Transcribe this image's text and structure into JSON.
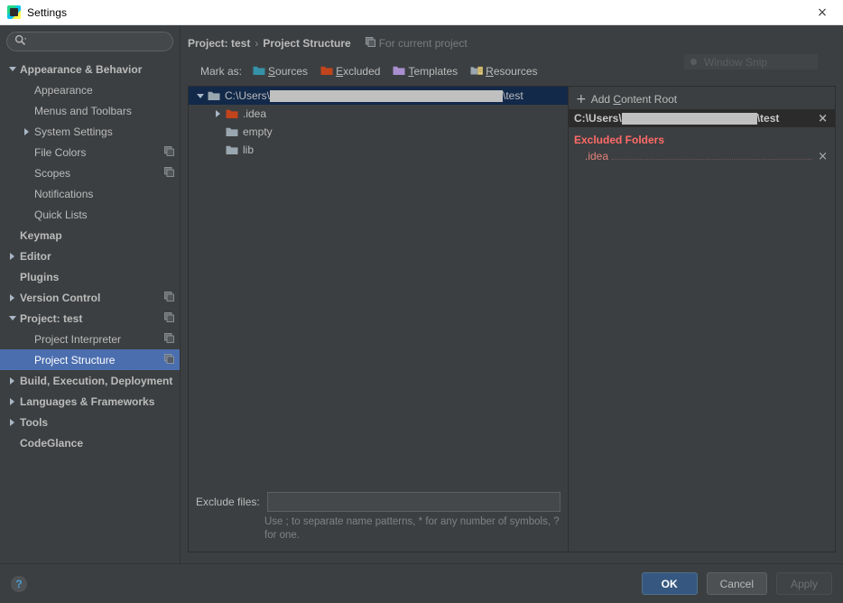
{
  "window": {
    "title": "Settings",
    "close_icon": "×"
  },
  "search": {
    "placeholder": "",
    "value": "",
    "icon": "search-icon"
  },
  "sidebar": {
    "items": [
      {
        "label": "Appearance & Behavior",
        "level": 0,
        "arrow": "expanded",
        "bold": true,
        "badge": false,
        "selected": false
      },
      {
        "label": "Appearance",
        "level": 1,
        "arrow": "none",
        "bold": false,
        "badge": false,
        "selected": false
      },
      {
        "label": "Menus and Toolbars",
        "level": 1,
        "arrow": "none",
        "bold": false,
        "badge": false,
        "selected": false
      },
      {
        "label": "System Settings",
        "level": 1,
        "arrow": "collapsed",
        "bold": false,
        "badge": false,
        "selected": false
      },
      {
        "label": "File Colors",
        "level": 1,
        "arrow": "none",
        "bold": false,
        "badge": true,
        "selected": false
      },
      {
        "label": "Scopes",
        "level": 1,
        "arrow": "none",
        "bold": false,
        "badge": true,
        "selected": false
      },
      {
        "label": "Notifications",
        "level": 1,
        "arrow": "none",
        "bold": false,
        "badge": false,
        "selected": false
      },
      {
        "label": "Quick Lists",
        "level": 1,
        "arrow": "none",
        "bold": false,
        "badge": false,
        "selected": false
      },
      {
        "label": "Keymap",
        "level": 0,
        "arrow": "none",
        "bold": true,
        "badge": false,
        "selected": false
      },
      {
        "label": "Editor",
        "level": 0,
        "arrow": "collapsed",
        "bold": true,
        "badge": false,
        "selected": false
      },
      {
        "label": "Plugins",
        "level": 0,
        "arrow": "none",
        "bold": true,
        "badge": false,
        "selected": false
      },
      {
        "label": "Version Control",
        "level": 0,
        "arrow": "collapsed",
        "bold": true,
        "badge": true,
        "selected": false
      },
      {
        "label": "Project: test",
        "level": 0,
        "arrow": "expanded",
        "bold": true,
        "badge": true,
        "selected": false
      },
      {
        "label": "Project Interpreter",
        "level": 1,
        "arrow": "none",
        "bold": false,
        "badge": true,
        "selected": false
      },
      {
        "label": "Project Structure",
        "level": 1,
        "arrow": "none",
        "bold": false,
        "badge": true,
        "selected": true
      },
      {
        "label": "Build, Execution, Deployment",
        "level": 0,
        "arrow": "collapsed",
        "bold": true,
        "badge": false,
        "selected": false
      },
      {
        "label": "Languages & Frameworks",
        "level": 0,
        "arrow": "collapsed",
        "bold": true,
        "badge": false,
        "selected": false
      },
      {
        "label": "Tools",
        "level": 0,
        "arrow": "collapsed",
        "bold": true,
        "badge": false,
        "selected": false
      },
      {
        "label": "CodeGlance",
        "level": 0,
        "arrow": "none",
        "bold": true,
        "badge": false,
        "selected": false
      }
    ]
  },
  "breadcrumb": {
    "parent": "Project: test",
    "separator": "›",
    "current": "Project Structure",
    "scope_label": "For current project"
  },
  "mark_as": {
    "label": "Mark as:",
    "options": [
      {
        "label": "Sources",
        "mnemonic": "S",
        "rest": "ources",
        "color": "#3592a8",
        "icon": "folder-sources-icon"
      },
      {
        "label": "Excluded",
        "mnemonic": "E",
        "rest": "xcluded",
        "color": "#c1441d",
        "icon": "folder-excluded-icon"
      },
      {
        "label": "Templates",
        "mnemonic": "T",
        "rest": "emplates",
        "color": "#a98fd0",
        "icon": "folder-templates-icon"
      },
      {
        "label": "Resources",
        "mnemonic": "R",
        "rest": "esources",
        "color": "#9aa7b0",
        "icon": "folder-resources-icon"
      }
    ]
  },
  "file_tree": {
    "rows": [
      {
        "name_prefix": "C:\\Users\\",
        "redacted": true,
        "name_suffix": "\\test",
        "indent": 0,
        "arrow": "expanded",
        "folder_color": "#9aa7b0",
        "selected": true
      },
      {
        "name_prefix": ".idea",
        "redacted": false,
        "name_suffix": "",
        "indent": 1,
        "arrow": "collapsed",
        "folder_color": "#c1441d",
        "selected": false
      },
      {
        "name_prefix": "empty",
        "redacted": false,
        "name_suffix": "",
        "indent": 1,
        "arrow": "none",
        "folder_color": "#9aa7b0",
        "selected": false
      },
      {
        "name_prefix": "lib",
        "redacted": false,
        "name_suffix": "",
        "indent": 1,
        "arrow": "none",
        "folder_color": "#9aa7b0",
        "selected": false
      }
    ]
  },
  "exclude_files": {
    "label": "Exclude files:",
    "value": "",
    "placeholder": "",
    "hint": "Use ; to separate name patterns, * for any number of symbols, ? for one."
  },
  "detail": {
    "add_content_root": {
      "plus": "+",
      "mnemonic": "C",
      "before": "Add ",
      "after": "ontent Root"
    },
    "content_root": {
      "prefix": "C:\\Users\\",
      "redacted": true,
      "suffix": "\\test",
      "remove_icon": "×"
    },
    "excluded_folders": {
      "title": "Excluded Folders",
      "color": "#ff6b68",
      "items": [
        {
          "name": ".idea",
          "remove_icon": "×"
        }
      ]
    }
  },
  "snip_overlay": {
    "label": "Window Snip"
  },
  "footer": {
    "help": "?",
    "ok": "OK",
    "cancel": "Cancel",
    "apply": "Apply"
  }
}
